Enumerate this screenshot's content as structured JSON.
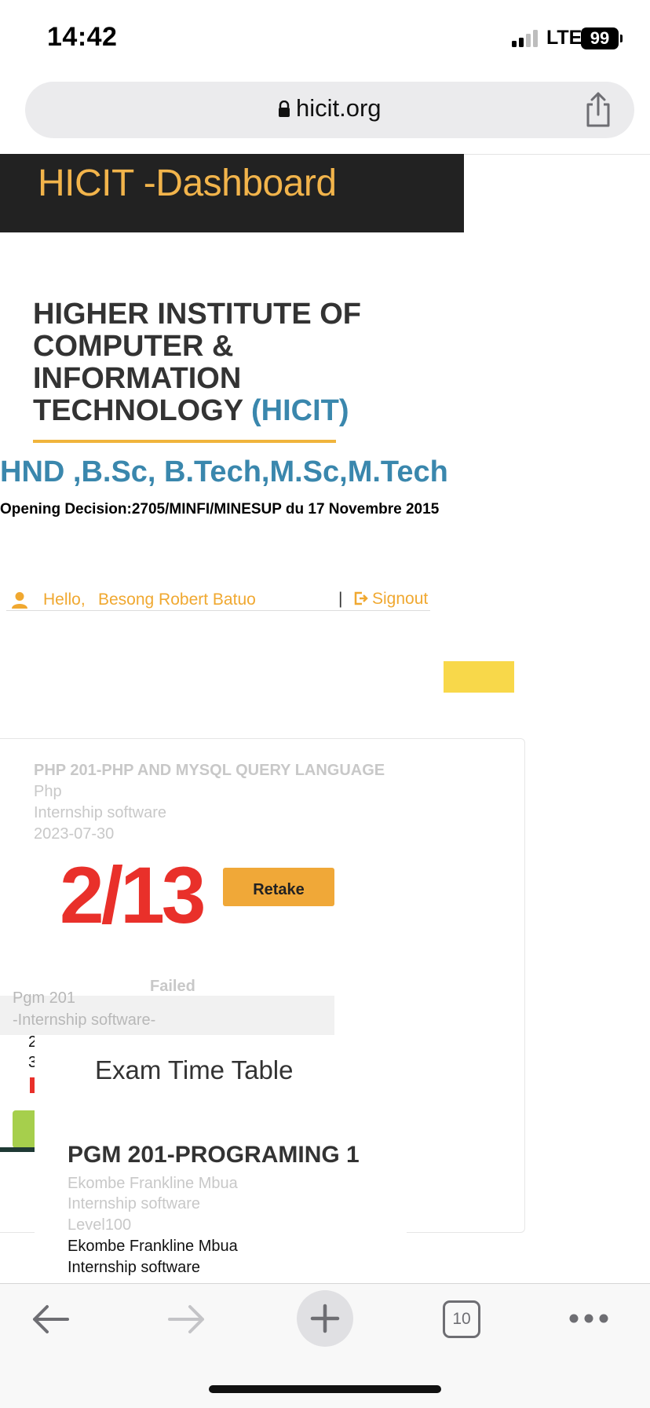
{
  "status_bar": {
    "time": "14:42",
    "network": "LTE",
    "battery": "99"
  },
  "browser": {
    "url": "hicit.org",
    "tab_count": "10"
  },
  "dashboard": {
    "title": "HICIT -Dashboard"
  },
  "institute": {
    "name": "HIGHER INSTITUTE OF COMPUTER & INFORMATION TECHNOLOGY",
    "abbr": "(HICIT)",
    "degrees": "HND ,B.Sc, B.Tech,M.Sc,M.Tech",
    "opening_decision": "Opening Decision:2705/MINFI/MINESUP du 17 Novembre 2015"
  },
  "greeting": {
    "hello": "Hello,",
    "user_name": "Besong Robert Batuo",
    "separator": "|",
    "signout": "Signout"
  },
  "course_card": {
    "title": "PHP 201-PHP AND MYSQL QUERY LANGUAGE",
    "subject": "Php",
    "department": "Internship software",
    "date": "2023-07-30",
    "score": "2/13",
    "retake_label": "Retake",
    "status": "Failed"
  },
  "partial_card": {
    "course": "Pgm 201",
    "department": "-Internship software-",
    "line_1": "2",
    "line_2": "3"
  },
  "exam_timetable": {
    "title": "Exam Time Table",
    "course": "PGM 201-PROGRAMING 1",
    "lecturer": "Ekombe Frankline Mbua",
    "department": "Internship software",
    "level": "Level100",
    "lecturer_repeat": "Ekombe Frankline Mbua",
    "department_repeat": "Internship software"
  },
  "colors": {
    "accent_orange": "#f0a838",
    "header_bg": "#222222",
    "header_text": "#f2b44b",
    "link_blue": "#3a87ad",
    "score_red": "#e9302a",
    "highlight_yellow": "#f8d84a"
  },
  "icons": {
    "lock": "lock-icon",
    "share": "share-icon",
    "user": "user-icon",
    "signout": "signout-icon",
    "back": "arrow-left-icon",
    "forward": "arrow-right-icon",
    "new_tab": "plus-icon",
    "more": "ellipsis-icon"
  }
}
